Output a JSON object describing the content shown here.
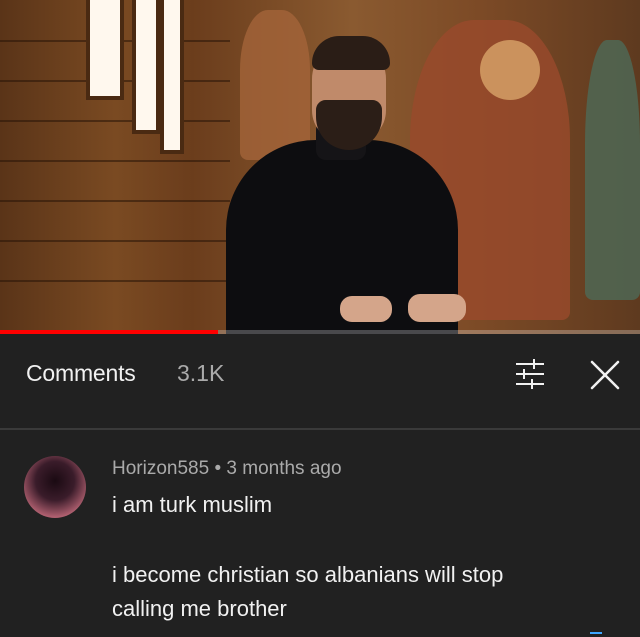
{
  "video": {
    "progress_fraction": 0.34
  },
  "comments_panel": {
    "title": "Comments",
    "count": "3.1K",
    "filter_icon": "sliders-icon",
    "close_icon": "close-icon"
  },
  "comment": {
    "author": "Horizon585",
    "separator": " • ",
    "time": "3 months ago",
    "lines": [
      "i am turk muslim",
      "i become christian so albanians will stop",
      "calling me brother"
    ]
  }
}
